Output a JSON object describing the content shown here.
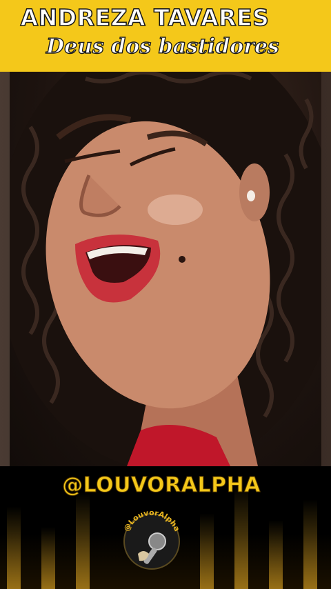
{
  "header": {
    "artist": "ANDREZA TAVARES",
    "song": "Deus dos bastidores"
  },
  "video": {
    "description_icon": "singer-video"
  },
  "footer": {
    "handle": "@LOUVORALPHA",
    "logo_text": "@LouvorAlpha"
  },
  "colors": {
    "header_bg": "#f4c81a",
    "handle_text": "#f4c81a",
    "footer_bg": "#000000"
  }
}
